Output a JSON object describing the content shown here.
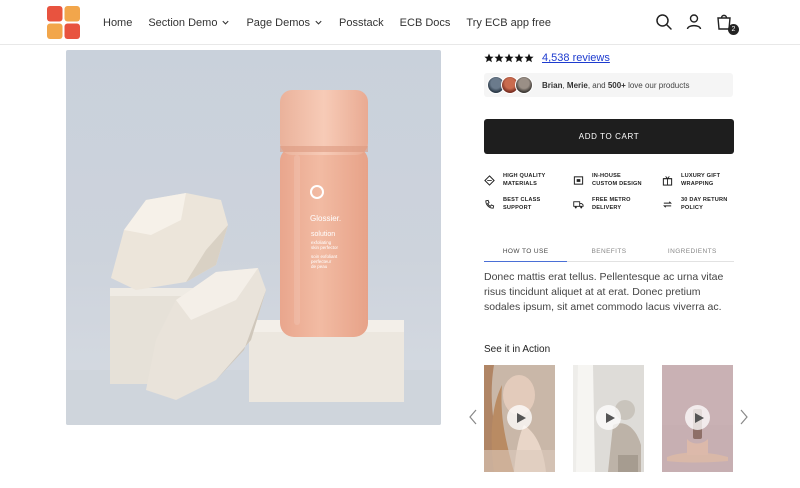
{
  "header": {
    "nav": [
      {
        "label": "Home",
        "dropdown": false
      },
      {
        "label": "Section Demo",
        "dropdown": true
      },
      {
        "label": "Page Demos",
        "dropdown": true
      },
      {
        "label": "Posstack",
        "dropdown": false
      },
      {
        "label": "ECB Docs",
        "dropdown": false
      },
      {
        "label": "Try ECB app free",
        "dropdown": false
      }
    ],
    "cart_count": "2",
    "icons": [
      "search-icon",
      "account-icon",
      "cart-icon"
    ],
    "logo_colors": [
      "#e8533f",
      "#f2a64b",
      "#e8533f",
      "#f2a64b"
    ]
  },
  "product": {
    "bottle_brand": "Glossier.",
    "bottle_name": "solution",
    "bottle_sub1": "exfoliating",
    "bottle_sub2": "skin perfector",
    "bottle_fr1": "soin exfoliant",
    "bottle_fr2": "perfecteur",
    "bottle_fr3": "de peau"
  },
  "rating": {
    "stars": 5,
    "reviews_label": "4,538 reviews"
  },
  "social_proof": {
    "name1": "Brian",
    "name2": "Merie",
    "count": "500+",
    "sep1": ", ",
    "sep2": ", and ",
    "tail": " love our products"
  },
  "add_to_cart": "ADD TO CART",
  "features": [
    {
      "line1": "HIGH QUALITY",
      "line2": "MATERIALS",
      "icon": "diamond-icon"
    },
    {
      "line1": "IN-HOUSE",
      "line2": "CUSTOM DESIGN",
      "icon": "custom-design-icon"
    },
    {
      "line1": "LUXURY GIFT",
      "line2": "WRAPPING",
      "icon": "gift-icon"
    },
    {
      "line1": "BEST CLASS",
      "line2": "SUPPORT",
      "icon": "phone-icon"
    },
    {
      "line1": "FREE METRO",
      "line2": "DELIVERY",
      "icon": "truck-icon"
    },
    {
      "line1": "30 DAY RETURN",
      "line2": "POLICY",
      "icon": "return-icon"
    }
  ],
  "tabs": [
    {
      "label": "HOW TO USE",
      "active": true
    },
    {
      "label": "BENEFITS",
      "active": false
    },
    {
      "label": "INGREDIENTS",
      "active": false
    }
  ],
  "description": "Donec mattis erat tellus. Pellentesque ac urna vitae risus tincidunt aliquet at at erat. Donec pretium sodales ipsum, sit amet commodo lacus viverra ac.",
  "see_it_in_action": "See it in Action",
  "colors": {
    "accent_link": "#1d3bcf",
    "button_bg": "#1e1e1e",
    "tab_underline": "#4a6fd6"
  }
}
